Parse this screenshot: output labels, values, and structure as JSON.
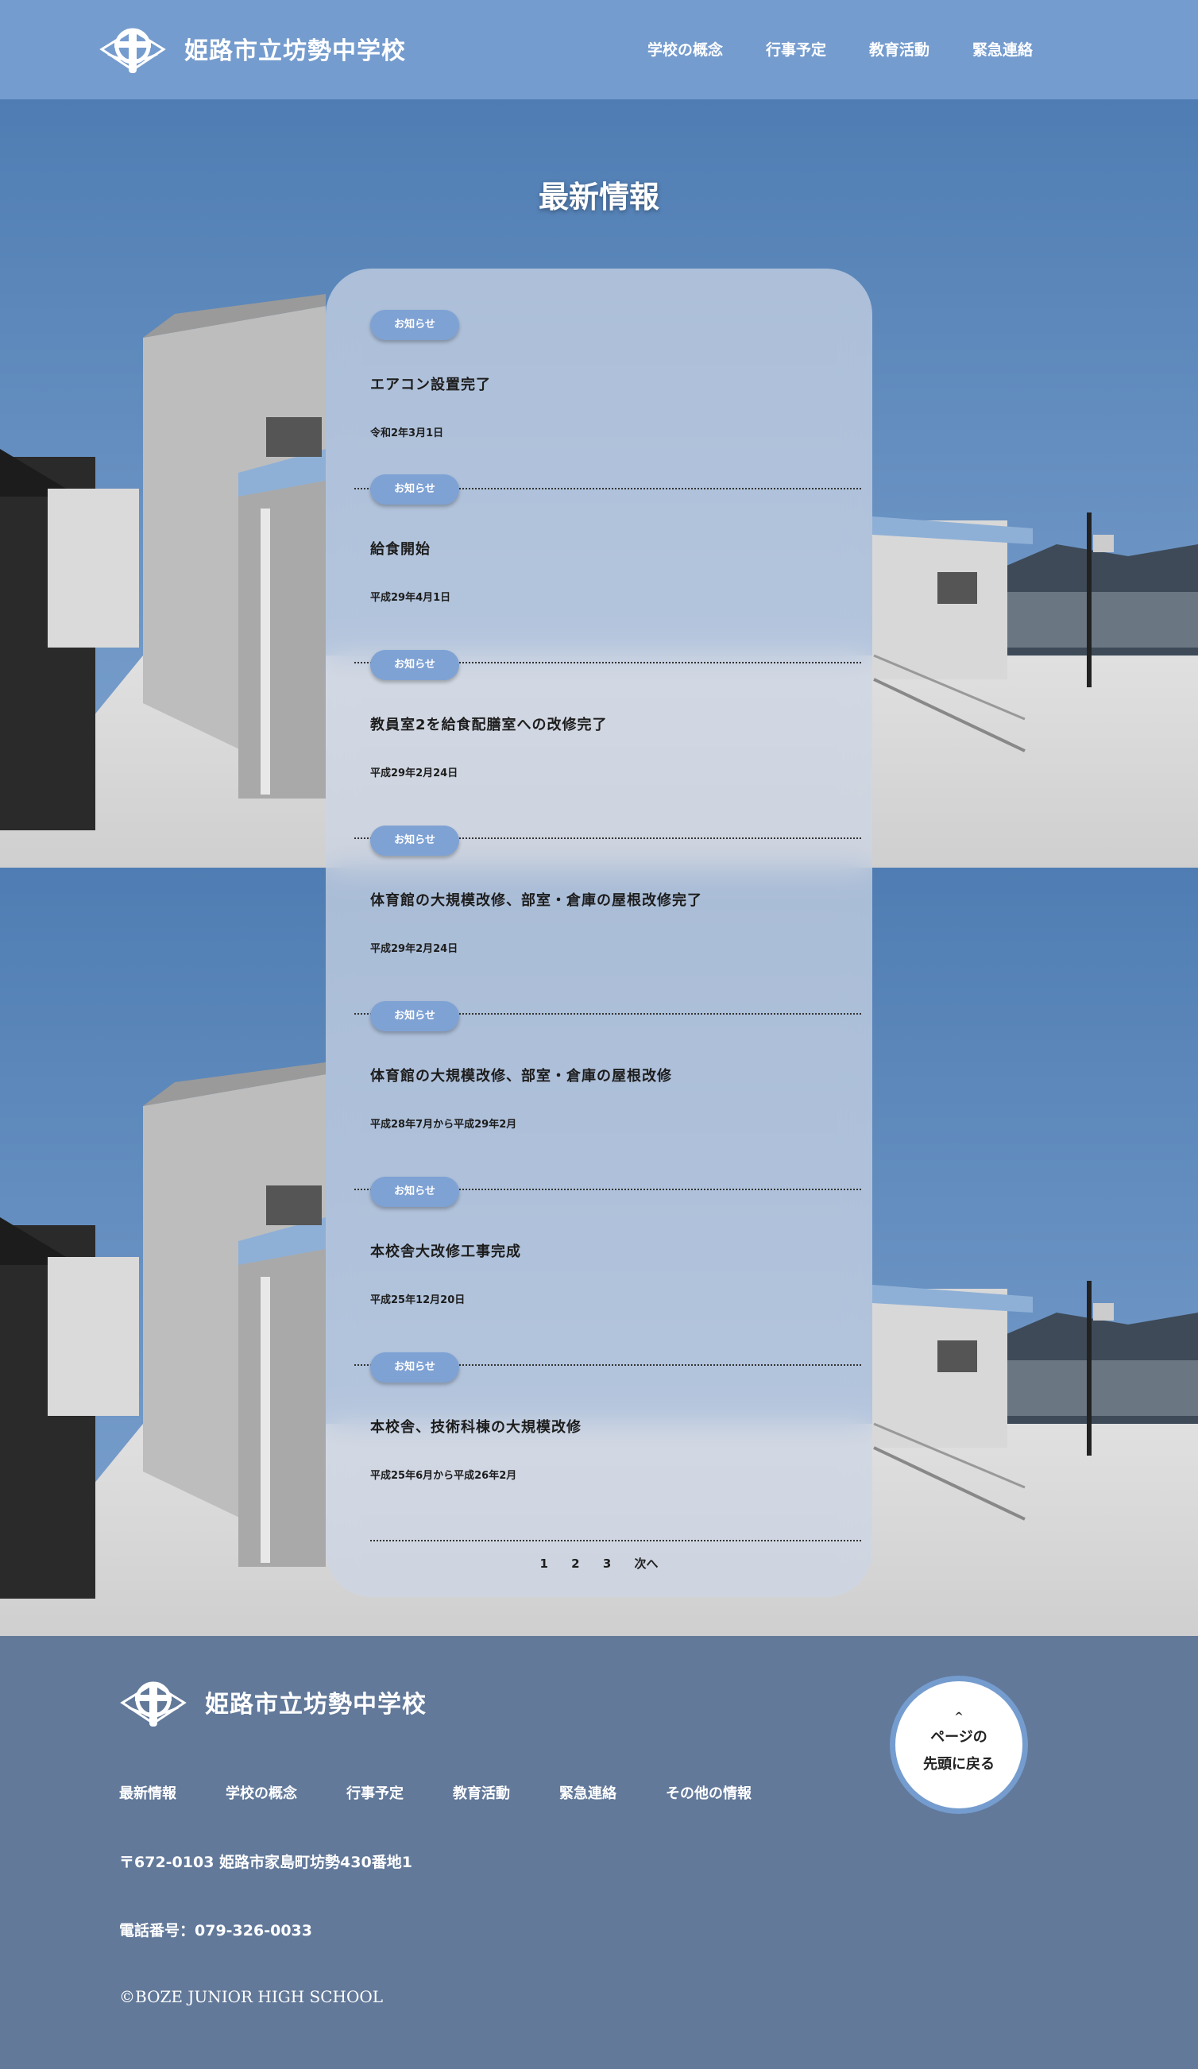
{
  "header": {
    "school_name": "姫路市立坊勢中学校",
    "logo_icon": "school-emblem-icon",
    "nav": [
      "学校の概念",
      "行事予定",
      "教育活動",
      "緊急連絡"
    ]
  },
  "section": {
    "title": "最新情報"
  },
  "news": [
    {
      "badge": "お知らせ",
      "title": "エアコン設置完了",
      "date": "令和2年3月1日"
    },
    {
      "badge": "お知らせ",
      "title": "給食開始",
      "date": "平成29年4月1日"
    },
    {
      "badge": "お知らせ",
      "title": "教員室2を給食配膳室への改修完了",
      "date": "平成29年2月24日"
    },
    {
      "badge": "お知らせ",
      "title": "体育館の大規模改修、部室・倉庫の屋根改修完了",
      "date": "平成29年2月24日"
    },
    {
      "badge": "お知らせ",
      "title": "体育館の大規模改修、部室・倉庫の屋根改修",
      "date": "平成28年7月から平成29年2月"
    },
    {
      "badge": "お知らせ",
      "title": "本校舎大改修工事完成",
      "date": "平成25年12月20日"
    },
    {
      "badge": "お知らせ",
      "title": "本校舎、技術科棟の大規模改修",
      "date": "平成25年6月から平成26年2月"
    }
  ],
  "pager": {
    "pages": [
      "1",
      "2",
      "3"
    ],
    "next": "次へ"
  },
  "footer": {
    "school_name": "姫路市立坊勢中学校",
    "links": [
      "最新情報",
      "学校の概念",
      "行事予定",
      "教育活動",
      "緊急連絡",
      "その他の情報"
    ],
    "address": "〒672-0103 姫路市家島町坊勢430番地1",
    "tel": "電話番号：079-326-0033",
    "copyright": "©BOZE JUNIOR HIGH SCHOOL",
    "totop_line1": "ページの",
    "totop_line2": "先頭に戻る",
    "totop_caret": "^"
  },
  "colors": {
    "header_bg": "#759cce",
    "footer_bg": "#62799a",
    "badge_bg": "#7fa2d4",
    "sky": "#5b86ba"
  }
}
